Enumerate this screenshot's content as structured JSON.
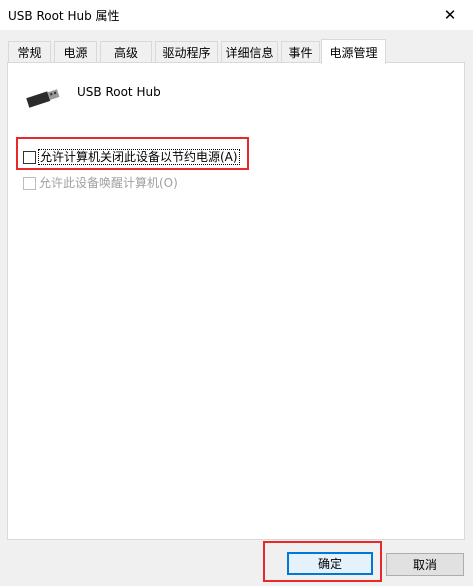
{
  "window": {
    "title": "USB Root Hub 属性",
    "close_glyph": "✕"
  },
  "tabs": [
    {
      "label": "常规"
    },
    {
      "label": "电源"
    },
    {
      "label": "高级"
    },
    {
      "label": "驱动程序"
    },
    {
      "label": "详细信息"
    },
    {
      "label": "事件"
    },
    {
      "label": "电源管理"
    }
  ],
  "active_tab": "电源管理",
  "device": {
    "name": "USB Root Hub",
    "icon": "usb-connector-icon"
  },
  "options": {
    "allow_power_off": {
      "label": "允许计算机关闭此设备以节约电源(A)",
      "checked": false
    },
    "allow_wake": {
      "label": "允许此设备唤醒计算机(O)",
      "checked": false,
      "enabled": false
    }
  },
  "buttons": {
    "ok": "确定",
    "cancel": "取消"
  },
  "colors": {
    "annotation_red": "#e8292a",
    "focus_blue": "#0078d7"
  }
}
